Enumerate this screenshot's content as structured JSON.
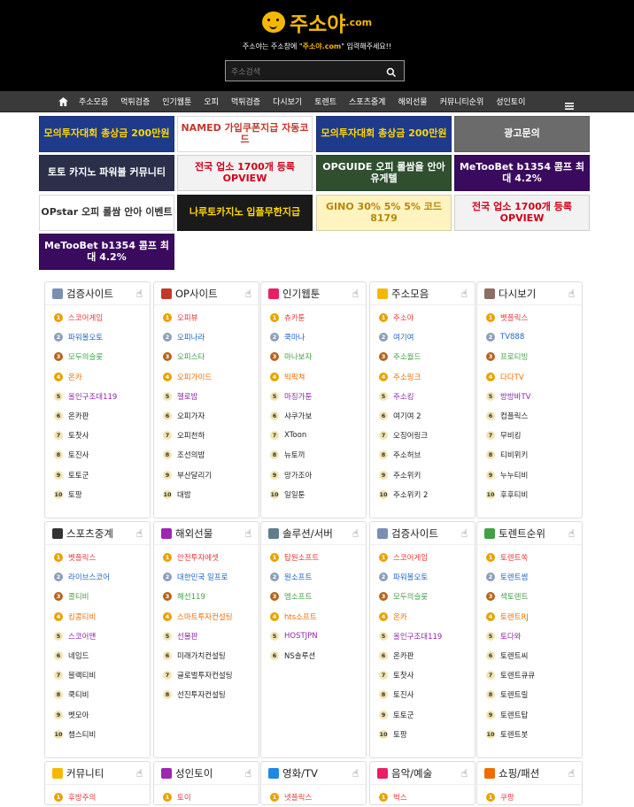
{
  "header": {
    "brand": "주소야",
    "domain": ".com",
    "tagline_pre": "주소야는 주소창에 \"",
    "tagline_hl": "주소야.com",
    "tagline_post": "\" 입력해주세요!!",
    "search_placeholder": "주소검색"
  },
  "nav": {
    "items": [
      "주소모음",
      "먹튀검증",
      "인기웹툰",
      "오피",
      "먹튀검증",
      "다시보기",
      "토렌트",
      "스포츠중계",
      "해외선물",
      "커뮤니티순위",
      "성인토이"
    ]
  },
  "banners": [
    {
      "text": "모의투자대회 총상금 200만원",
      "bg": "#1e3a8a",
      "fg": "#ffd700"
    },
    {
      "text": "NAMED 가입쿠폰지급 자동코드",
      "bg": "#ffffff",
      "fg": "#c0392b"
    },
    {
      "text": "모의투자대회 총상금 200만원",
      "bg": "#1e3a8a",
      "fg": "#ffd700"
    },
    {
      "text": "광고문의",
      "bg": "#6b6b6b",
      "fg": "#ffffff"
    },
    {
      "text": "토토 카지노 파워볼 커뮤니티",
      "bg": "#2b2f4a",
      "fg": "#ffffff"
    },
    {
      "text": "전국 업소 1700개 등록 OPVIEW",
      "bg": "#f2f2f2",
      "fg": "#d0021b"
    },
    {
      "text": "OPGUIDE 오피 롤쌈을 안아 유게텔",
      "bg": "#2f4f2f",
      "fg": "#ffffff"
    },
    {
      "text": "MeTooBet b1354 콤프 최대 4.2%",
      "bg": "#3a0a5e",
      "fg": "#ffffff"
    },
    {
      "text": "OPstar 오피 롤쌈 안아 이벤트",
      "bg": "#ffffff",
      "fg": "#333333"
    },
    {
      "text": "나루토카지노 입플무한지급",
      "bg": "#1a1a1a",
      "fg": "#ffd700"
    },
    {
      "text": "GINO 30% 5% 5% 코드 8179",
      "bg": "#fff3c0",
      "fg": "#b8860b"
    },
    {
      "text": "전국 업소 1700개 등록 OPVIEW",
      "bg": "#f2f2f2",
      "fg": "#d0021b"
    },
    {
      "text": "MeTooBet b1354 콤프 최대 4.2%",
      "bg": "#3a0a5e",
      "fg": "#ffffff"
    }
  ],
  "panels": [
    {
      "title": "검증사이트",
      "icon_color": "#7b8fb0",
      "items": [
        {
          "name": "스코어게임",
          "color": "#e53935"
        },
        {
          "name": "파워볼오토",
          "color": "#1e63c4"
        },
        {
          "name": "모두의슬롯",
          "color": "#43a047"
        },
        {
          "name": "온카",
          "color": "#ef6c00"
        },
        {
          "name": "올인구조대119",
          "color": "#8e24aa"
        },
        {
          "name": "온카판",
          "color": "#222"
        },
        {
          "name": "토찻사",
          "color": "#222"
        },
        {
          "name": "토진사",
          "color": "#222"
        },
        {
          "name": "토토군",
          "color": "#222"
        },
        {
          "name": "토팡",
          "color": "#222"
        }
      ]
    },
    {
      "title": "OP사이트",
      "icon_color": "#c0392b",
      "items": [
        {
          "name": "오피뷰",
          "color": "#e53935"
        },
        {
          "name": "오피나라",
          "color": "#1e63c4"
        },
        {
          "name": "오피스타",
          "color": "#43a047"
        },
        {
          "name": "오피가이드",
          "color": "#ef6c00"
        },
        {
          "name": "헬로밤",
          "color": "#8e24aa"
        },
        {
          "name": "오피가자",
          "color": "#222"
        },
        {
          "name": "오피천하",
          "color": "#222"
        },
        {
          "name": "조선의밤",
          "color": "#222"
        },
        {
          "name": "부산달리기",
          "color": "#222"
        },
        {
          "name": "대밤",
          "color": "#222"
        }
      ]
    },
    {
      "title": "인기웹툰",
      "icon_color": "#e91e63",
      "items": [
        {
          "name": "츄카툰",
          "color": "#e53935"
        },
        {
          "name": "쿡마나",
          "color": "#1e63c4"
        },
        {
          "name": "마나보자",
          "color": "#43a047"
        },
        {
          "name": "빅픽쳐",
          "color": "#ef6c00"
        },
        {
          "name": "마징가툰",
          "color": "#8e24aa"
        },
        {
          "name": "샤쿠가보",
          "color": "#222"
        },
        {
          "name": "XToon",
          "color": "#222"
        },
        {
          "name": "뉴토끼",
          "color": "#222"
        },
        {
          "name": "망가조아",
          "color": "#222"
        },
        {
          "name": "일일툰",
          "color": "#222"
        }
      ]
    },
    {
      "title": "주소모음",
      "icon_color": "#f5b800",
      "items": [
        {
          "name": "주소야",
          "color": "#e53935"
        },
        {
          "name": "여기여",
          "color": "#1e63c4"
        },
        {
          "name": "주소월드",
          "color": "#43a047"
        },
        {
          "name": "주소링크",
          "color": "#ef6c00"
        },
        {
          "name": "주소킹",
          "color": "#8e24aa"
        },
        {
          "name": "여기여 2",
          "color": "#222"
        },
        {
          "name": "오징어링크",
          "color": "#222"
        },
        {
          "name": "주소허브",
          "color": "#222"
        },
        {
          "name": "주소위키",
          "color": "#222"
        },
        {
          "name": "주소위키 2",
          "color": "#222"
        }
      ]
    },
    {
      "title": "다시보기",
      "icon_color": "#8d6e63",
      "items": [
        {
          "name": "벳플릭스",
          "color": "#e53935"
        },
        {
          "name": "TV888",
          "color": "#1e63c4"
        },
        {
          "name": "프로티빙",
          "color": "#43a047"
        },
        {
          "name": "다다TV",
          "color": "#ef6c00"
        },
        {
          "name": "방방바TV",
          "color": "#8e24aa"
        },
        {
          "name": "컴플릭스",
          "color": "#222"
        },
        {
          "name": "무비킹",
          "color": "#222"
        },
        {
          "name": "티비위키",
          "color": "#222"
        },
        {
          "name": "누누티비",
          "color": "#222"
        },
        {
          "name": "후후티비",
          "color": "#222"
        }
      ]
    },
    {
      "title": "스포츠중계",
      "icon_color": "#333333",
      "items": [
        {
          "name": "벳플릭스",
          "color": "#e53935"
        },
        {
          "name": "라이브스코어",
          "color": "#1e63c4"
        },
        {
          "name": "콜티비",
          "color": "#43a047"
        },
        {
          "name": "킹콩티비",
          "color": "#ef6c00"
        },
        {
          "name": "스코어맨",
          "color": "#8e24aa"
        },
        {
          "name": "네임드",
          "color": "#222"
        },
        {
          "name": "블랙티비",
          "color": "#222"
        },
        {
          "name": "쿡티비",
          "color": "#222"
        },
        {
          "name": "벳모아",
          "color": "#222"
        },
        {
          "name": "챔스티비",
          "color": "#222"
        }
      ]
    },
    {
      "title": "해외선물",
      "icon_color": "#9c27b0",
      "items": [
        {
          "name": "안전투자에셋",
          "color": "#e53935"
        },
        {
          "name": "대한민국 일프로",
          "color": "#1e63c4"
        },
        {
          "name": "해선119",
          "color": "#43a047"
        },
        {
          "name": "스마트투자컨설팅",
          "color": "#ef6c00"
        },
        {
          "name": "선물판",
          "color": "#8e24aa"
        },
        {
          "name": "미래가치컨설팅",
          "color": "#222"
        },
        {
          "name": "글로벌투자컨설팅",
          "color": "#222"
        },
        {
          "name": "선진투자컨설팅",
          "color": "#222"
        }
      ]
    },
    {
      "title": "솔루션/서버",
      "icon_color": "#607d8b",
      "items": [
        {
          "name": "탑원소프트",
          "color": "#e53935"
        },
        {
          "name": "원소프트",
          "color": "#1e63c4"
        },
        {
          "name": "엠소프트",
          "color": "#43a047"
        },
        {
          "name": "hts소프트",
          "color": "#ef6c00"
        },
        {
          "name": "HOSTJPN",
          "color": "#8e24aa"
        },
        {
          "name": "NS솔루션",
          "color": "#222"
        }
      ]
    },
    {
      "title": "검증사이트",
      "icon_color": "#7b8fb0",
      "items": [
        {
          "name": "스코어게임",
          "color": "#e53935"
        },
        {
          "name": "파워볼오토",
          "color": "#1e63c4"
        },
        {
          "name": "모두의슬롯",
          "color": "#43a047"
        },
        {
          "name": "온카",
          "color": "#ef6c00"
        },
        {
          "name": "올인구조대119",
          "color": "#8e24aa"
        },
        {
          "name": "온카판",
          "color": "#222"
        },
        {
          "name": "토찻사",
          "color": "#222"
        },
        {
          "name": "토진사",
          "color": "#222"
        },
        {
          "name": "토토군",
          "color": "#222"
        },
        {
          "name": "토팡",
          "color": "#222"
        }
      ]
    },
    {
      "title": "토렌트순위",
      "icon_color": "#43a047",
      "items": [
        {
          "name": "토렌트쏙",
          "color": "#e53935"
        },
        {
          "name": "토렌트썸",
          "color": "#1e63c4"
        },
        {
          "name": "섹토렌트",
          "color": "#43a047"
        },
        {
          "name": "토렌트RJ",
          "color": "#ef6c00"
        },
        {
          "name": "토다와",
          "color": "#8e24aa"
        },
        {
          "name": "토렌트씨",
          "color": "#222"
        },
        {
          "name": "토렌트큐큐",
          "color": "#222"
        },
        {
          "name": "토렌트릴",
          "color": "#222"
        },
        {
          "name": "토렌트탑",
          "color": "#222"
        },
        {
          "name": "토렌트봇",
          "color": "#222"
        }
      ]
    },
    {
      "title": "커뮤니티",
      "icon_color": "#f5b800",
      "items": [
        {
          "name": "후방주의",
          "color": "#e53935"
        }
      ]
    },
    {
      "title": "성인토이",
      "icon_color": "#9c27b0",
      "items": [
        {
          "name": "토이",
          "color": "#e53935"
        }
      ]
    },
    {
      "title": "영화/TV",
      "icon_color": "#1e88e5",
      "items": [
        {
          "name": "넷플릭스",
          "color": "#e53935"
        }
      ]
    },
    {
      "title": "음악/예술",
      "icon_color": "#e91e63",
      "items": [
        {
          "name": "벅스",
          "color": "#e53935"
        }
      ]
    },
    {
      "title": "쇼핑/패션",
      "icon_color": "#ef6c00",
      "items": [
        {
          "name": "쿠팡",
          "color": "#e53935"
        }
      ]
    }
  ]
}
